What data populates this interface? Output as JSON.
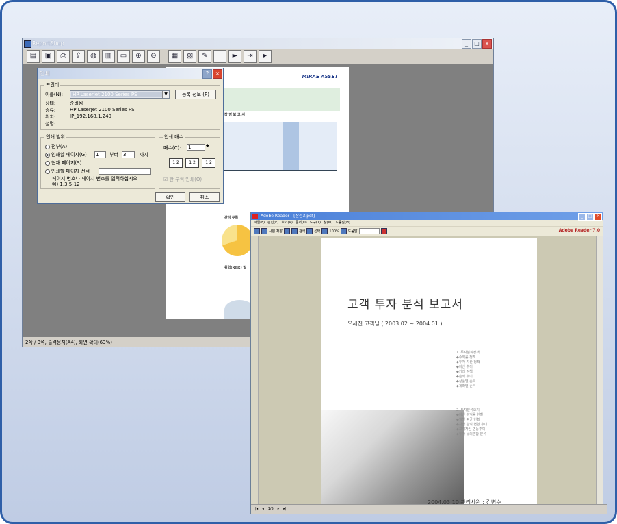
{
  "report_window": {
    "title": "ReportShop",
    "toolbar": [
      "preview-icon",
      "save-icon",
      "print-icon",
      "export-icon",
      "web-icon",
      "pdf-icon",
      "printer-icon",
      "zoom-in-icon",
      "zoom-out-icon",
      "page-setup-icon",
      "fit-icon",
      "tools-icon",
      "info-icon",
      "forward-icon",
      "export-doc-icon",
      "next-icon"
    ],
    "status": "2쪽 / 3쪽,  출력용지(A4),  화면 확대(63%)"
  },
  "print_dialog": {
    "title": "인쇄",
    "printer_group": "프린터",
    "name_label": "이름(N):",
    "name_value": "HP LaserJet 2100 Series PS",
    "properties_button": "등록 정보 (P)",
    "state_label": "상태:",
    "state_value": "준비됨",
    "type_label": "종류:",
    "type_value": "HP LaserJet 2100 Series PS",
    "where_label": "위치:",
    "where_value": "IP_192.168.1.240",
    "comment_label": "설명:",
    "range_group": "인쇄 범위",
    "range_all": "전부(A)",
    "range_pages": "인쇄할 페이지(G)",
    "from_value": "1",
    "from_label": "부터",
    "to_value": "3",
    "to_label": "까지",
    "range_current": "현재 페이지(S)",
    "range_select": "인쇄할 페이지 선택",
    "range_hint": "페이지 번호나 페이지 번호를 입력하십시오",
    "range_example": "예) 1,3,5-12",
    "copies_group": "인쇄 매수",
    "copies_label": "매수(C):",
    "copies_value": "1",
    "collate_label": "한 부씩 인쇄(O)",
    "ok": "확인",
    "cancel": "취소"
  },
  "report_page": {
    "logo": "MIRAE ASSET",
    "section1": "장 영 보 고 서",
    "section2": "관점 주목",
    "section3": "위험(Risk) 및"
  },
  "adobe_window": {
    "title": "Adobe Reader - [산정3.pdf]",
    "menu": [
      "파일(F)",
      "편집(E)",
      "보기(V)",
      "문서(D)",
      "도구(T)",
      "창(W)",
      "도움말(H)"
    ],
    "toolbar_save": "사본 저장",
    "toolbar_search": "검색",
    "toolbar_select": "선택",
    "toolbar_zoom": "100%",
    "toolbar_help": "도움말",
    "brand": "Adobe Reader 7.0",
    "doc_title": "고객 투자 분석 보고서",
    "doc_subtitle": "오세진 고객님 ( 2003.02 ~ 2004.01 )",
    "toc1_title": "1. 투자분석정책",
    "toc1": [
      "◆수익률 정책",
      "◆투자 자산 정책",
      "◆자산 추이",
      "◆거래 정책",
      "◆손익 추이",
      "◆상품별 손익",
      "◆계좌별 손익"
    ],
    "toc2_title": "2. 투자분석요지",
    "toc2": [
      "◆자산 수익률 현황",
      "◆월별 평균 현황",
      "◆자산 손익 현황 추이",
      "◆고객자산 변동추이",
      "◆투자 유의종합 분석"
    ],
    "footer": "2004.03.10  관리사원 : 김병수",
    "page_indicator": "1/5"
  },
  "colors": {
    "frame_border": "#2f5fa8",
    "dialog_bg": "#ece9d8",
    "adobe_title": "#4b80d8"
  }
}
